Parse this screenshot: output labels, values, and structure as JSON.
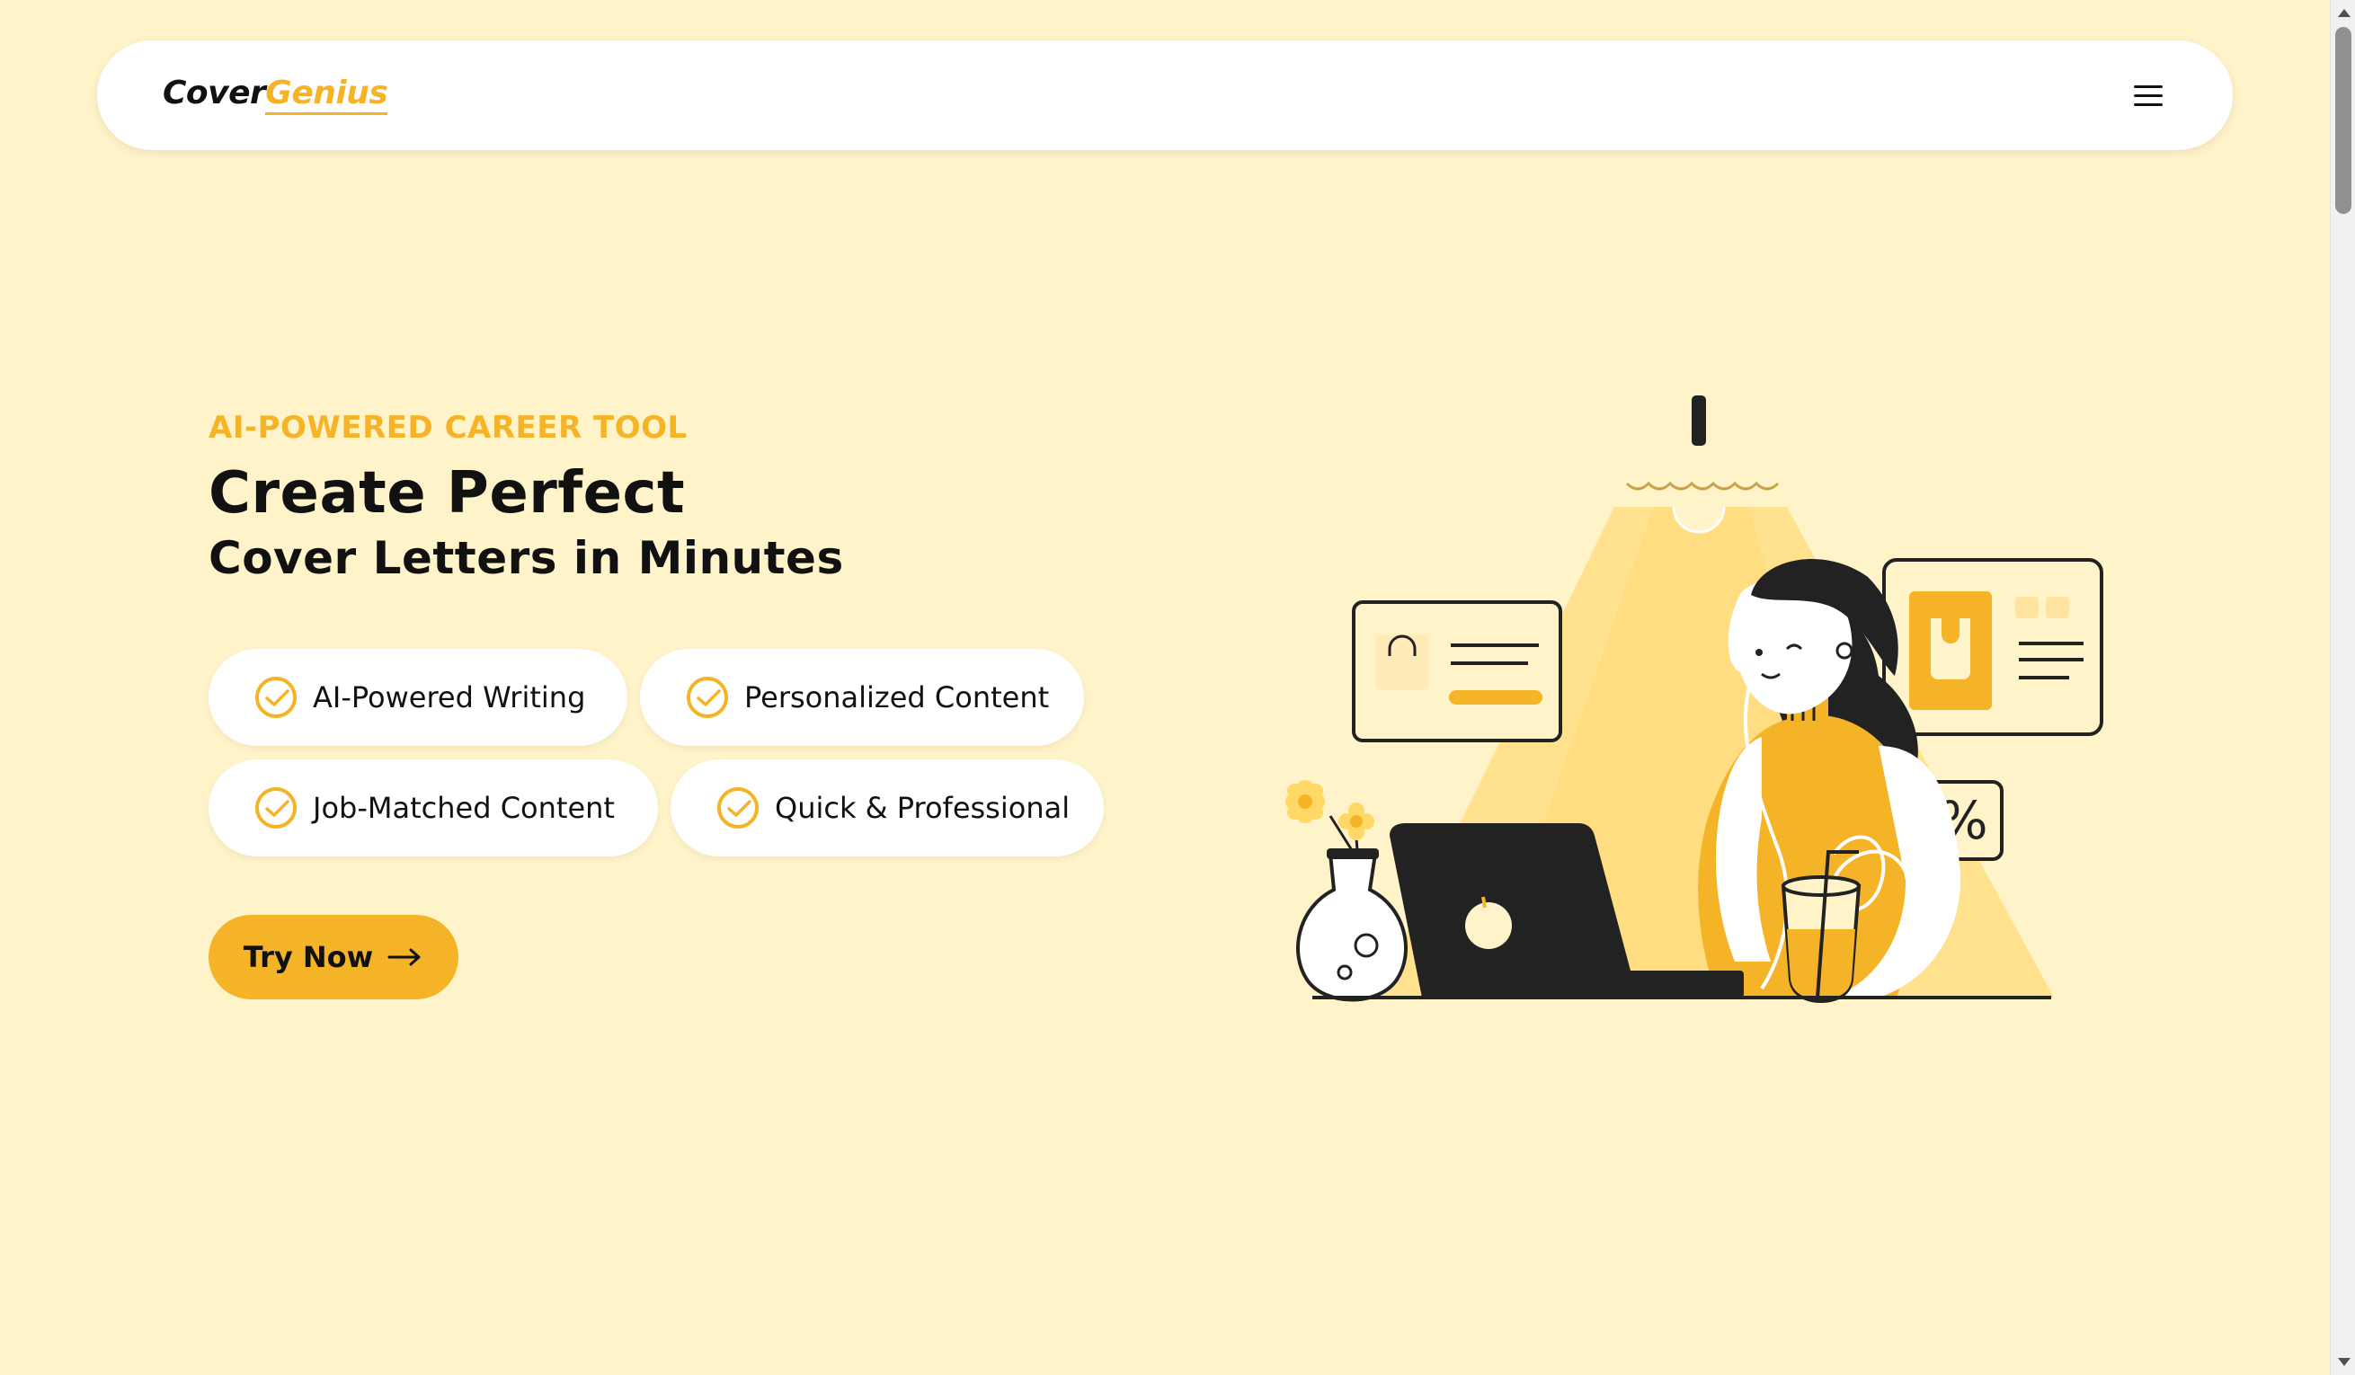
{
  "brand": {
    "logo_part1": "Cover",
    "logo_part2": "Genius"
  },
  "nav": {
    "menu_icon": "hamburger-menu-icon"
  },
  "hero": {
    "eyebrow": "AI-POWERED CAREER TOOL",
    "headline_line1": "Create Perfect",
    "headline_line2": "Cover Letters in Minutes",
    "features": [
      {
        "label": "AI-Powered Writing",
        "icon": "check-circle-icon"
      },
      {
        "label": "Personalized Content",
        "icon": "check-circle-icon"
      },
      {
        "label": "Job-Matched Content",
        "icon": "check-circle-icon"
      },
      {
        "label": "Quick & Professional",
        "icon": "check-circle-icon"
      }
    ],
    "cta_label": "Try Now",
    "cta_icon": "arrow-right-icon"
  },
  "illustration": {
    "percent_symbol": "%"
  },
  "colors": {
    "background": "#FFF3C9",
    "accent": "#F5B428",
    "text": "#111111",
    "card": "#FFFFFF"
  }
}
